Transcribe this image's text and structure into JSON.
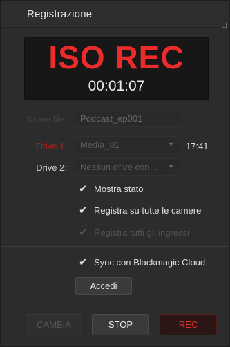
{
  "header": {
    "title": "Registrazione"
  },
  "display": {
    "status": "ISO REC",
    "timecode": "00:01:07"
  },
  "form": {
    "file_label": "Nome file:",
    "file_value": "Podcast_ep001",
    "drive1_label": "Drive 1:",
    "drive1_value": "Media_01",
    "drive1_time": "17:41",
    "drive2_label": "Drive 2:",
    "drive2_value": "Nessun drive con..."
  },
  "options": {
    "mostra_stato": {
      "label": "Mostra stato",
      "checked": true
    },
    "registra_camere": {
      "label": "Registra su tutte le camere",
      "checked": true
    },
    "registra_ingressi": {
      "label": "Registra tutti gli ingressi",
      "checked": true,
      "disabled": true
    }
  },
  "cloud": {
    "sync_label": "Sync con Blackmagic Cloud",
    "sync_checked": true,
    "login_label": "Accedi"
  },
  "footer": {
    "change_label": "CAMBIA",
    "stop_label": "STOP",
    "rec_label": "REC"
  },
  "icons": {
    "check": "checkmark-icon",
    "dropdown": "chevron-down-icon"
  },
  "colors": {
    "rec_red": "#ee2b2b",
    "background": "#2c2c2c",
    "display_bg": "#171717"
  }
}
